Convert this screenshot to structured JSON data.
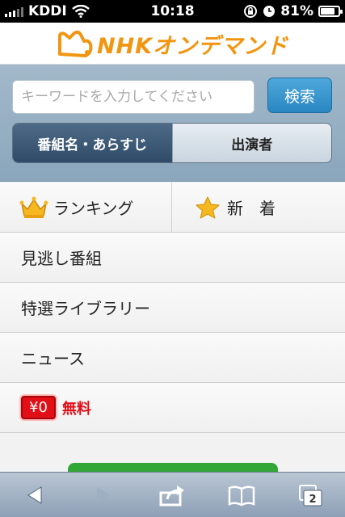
{
  "status_bar": {
    "carrier": "KDDI",
    "time": "10:18",
    "battery_percent": "81%",
    "battery_level": 0.81
  },
  "header": {
    "logo_text": "NHKオンデマンド"
  },
  "search": {
    "placeholder": "キーワードを入力してください",
    "value": "",
    "button_label": "検索",
    "segments": [
      "番組名・あらすじ",
      "出演者"
    ],
    "active_segment": 0
  },
  "menu": {
    "ranking_label": "ランキング",
    "new_label": "新　着",
    "items": [
      "見逃し番組",
      "特選ライブラリー",
      "ニュース"
    ],
    "free_badge": "¥0",
    "free_label": "無料"
  },
  "toolbar": {
    "tabs_count": "2"
  },
  "colors": {
    "accent_orange": "#f29511",
    "search_button": "#2a86c1",
    "free_red": "#e20f17"
  }
}
